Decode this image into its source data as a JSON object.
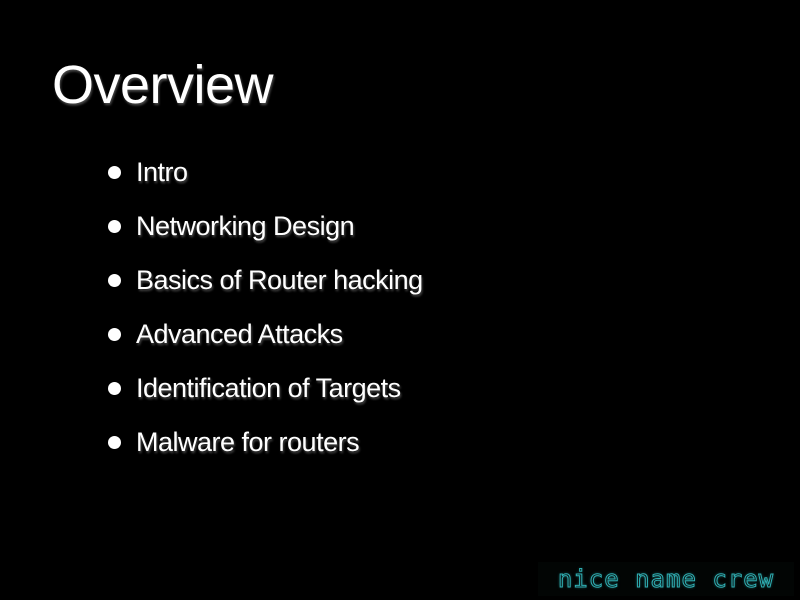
{
  "slide": {
    "title": "Overview",
    "bullets": [
      "Intro",
      "Networking Design",
      "Basics of Router hacking",
      "Advanced Attacks",
      "Identification of Targets",
      "Malware for routers"
    ]
  },
  "logo": {
    "text": "nice name crew",
    "color": "#2fb0b4"
  },
  "colors": {
    "background": "#000000",
    "text": "#ffffff"
  }
}
